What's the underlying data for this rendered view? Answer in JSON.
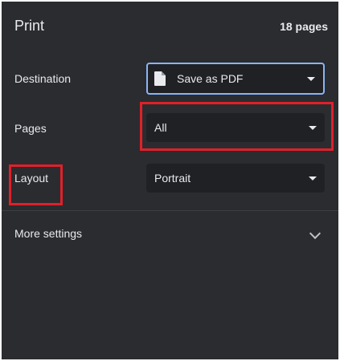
{
  "header": {
    "title": "Print",
    "page_count": "18 pages"
  },
  "settings": {
    "destination": {
      "label": "Destination",
      "value": "Save as PDF",
      "icon": "document-icon"
    },
    "pages": {
      "label": "Pages",
      "value": "All"
    },
    "layout": {
      "label": "Layout",
      "value": "Portrait"
    }
  },
  "more_settings": {
    "label": "More settings"
  },
  "colors": {
    "panel_bg": "#2b2c2f",
    "select_bg": "#202124",
    "focus_border": "#8ab4f8",
    "annotation_red": "#e0202a"
  }
}
